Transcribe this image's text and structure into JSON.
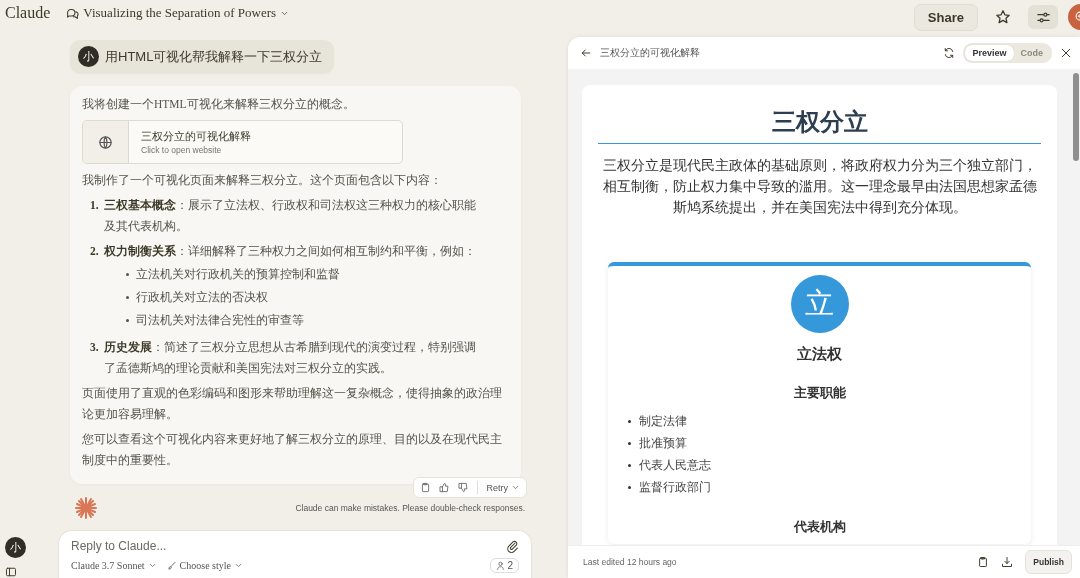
{
  "app": {
    "logo": "Claude"
  },
  "conversation": {
    "title": "Visualizing the Separation of Powers"
  },
  "top_actions": {
    "share": "Share",
    "starred": false
  },
  "user_message": {
    "avatar": "小",
    "text": "用HTML可视化帮我解释一下三权分立"
  },
  "assistant_message": {
    "intro": "我将创建一个HTML可视化来解释三权分立的概念。",
    "artifact": {
      "title": "三权分立的可视化解释",
      "subtitle": "Click to open website"
    },
    "lead": "我制作了一个可视化页面来解释三权分立。这个页面包含以下内容：",
    "points": [
      {
        "number": "1.",
        "text": "**三权基本概念**：展示了立法权、行政权和司法权这三种权力的核心职能及其代表机构。"
      },
      {
        "number": "2.",
        "text": "**权力制衡关系**：详细解释了三种权力之间如何相互制约和平衡，例如：",
        "bullets": [
          "立法机关对行政机关的预算控制和监督",
          "行政机关对立法的否决权",
          "司法机关对法律合宪性的审查等"
        ]
      },
      {
        "number": "3.",
        "text": "**历史发展**：简述了三权分立思想从古希腊到现代的演变过程，特别强调了孟德斯鸠的理论贡献和美国宪法对三权分立的实践。"
      }
    ],
    "paragraphs": [
      "页面使用了直观的色彩编码和图形来帮助理解这一复杂概念，使得抽象的政治理论更加容易理解。",
      "您可以查看这个可视化内容来更好地了解三权分立的原理、目的以及在现代民主制度中的重要性。"
    ]
  },
  "message_actions": {
    "retry": "Retry"
  },
  "disclaimer": "Claude can make mistakes. Please double-check responses.",
  "composer": {
    "placeholder": "Reply to Claude...",
    "model": "Claude 3.7 Sonnet",
    "style": "Choose style",
    "count": "2"
  },
  "account": {
    "avatar": "小"
  },
  "artifact_panel": {
    "title": "三权分立的可视化解释",
    "view_tabs": [
      {
        "label": "Preview",
        "selected": true
      },
      {
        "label": "Code",
        "selected": false
      }
    ],
    "page": {
      "title": "三权分立",
      "intro": "三权分立是现代民主政体的基础原则，将政府权力分为三个独立部门，相互制衡，防止权力集中导致的滥用。这一理念最早由法国思想家孟德斯鸠系统提出，并在美国宪法中得到充分体现。",
      "branches": [
        {
          "symbol": "立",
          "name": "立法权",
          "color": "#3498db",
          "sections": [
            {
              "heading": "主要职能",
              "items": [
                "制定法律",
                "批准预算",
                "代表人民意志",
                "监督行政部门"
              ]
            },
            {
              "heading": "代表机构"
            }
          ]
        }
      ]
    },
    "footer": {
      "last_edited": "Last edited 12 hours ago",
      "publish": "Publish"
    }
  }
}
